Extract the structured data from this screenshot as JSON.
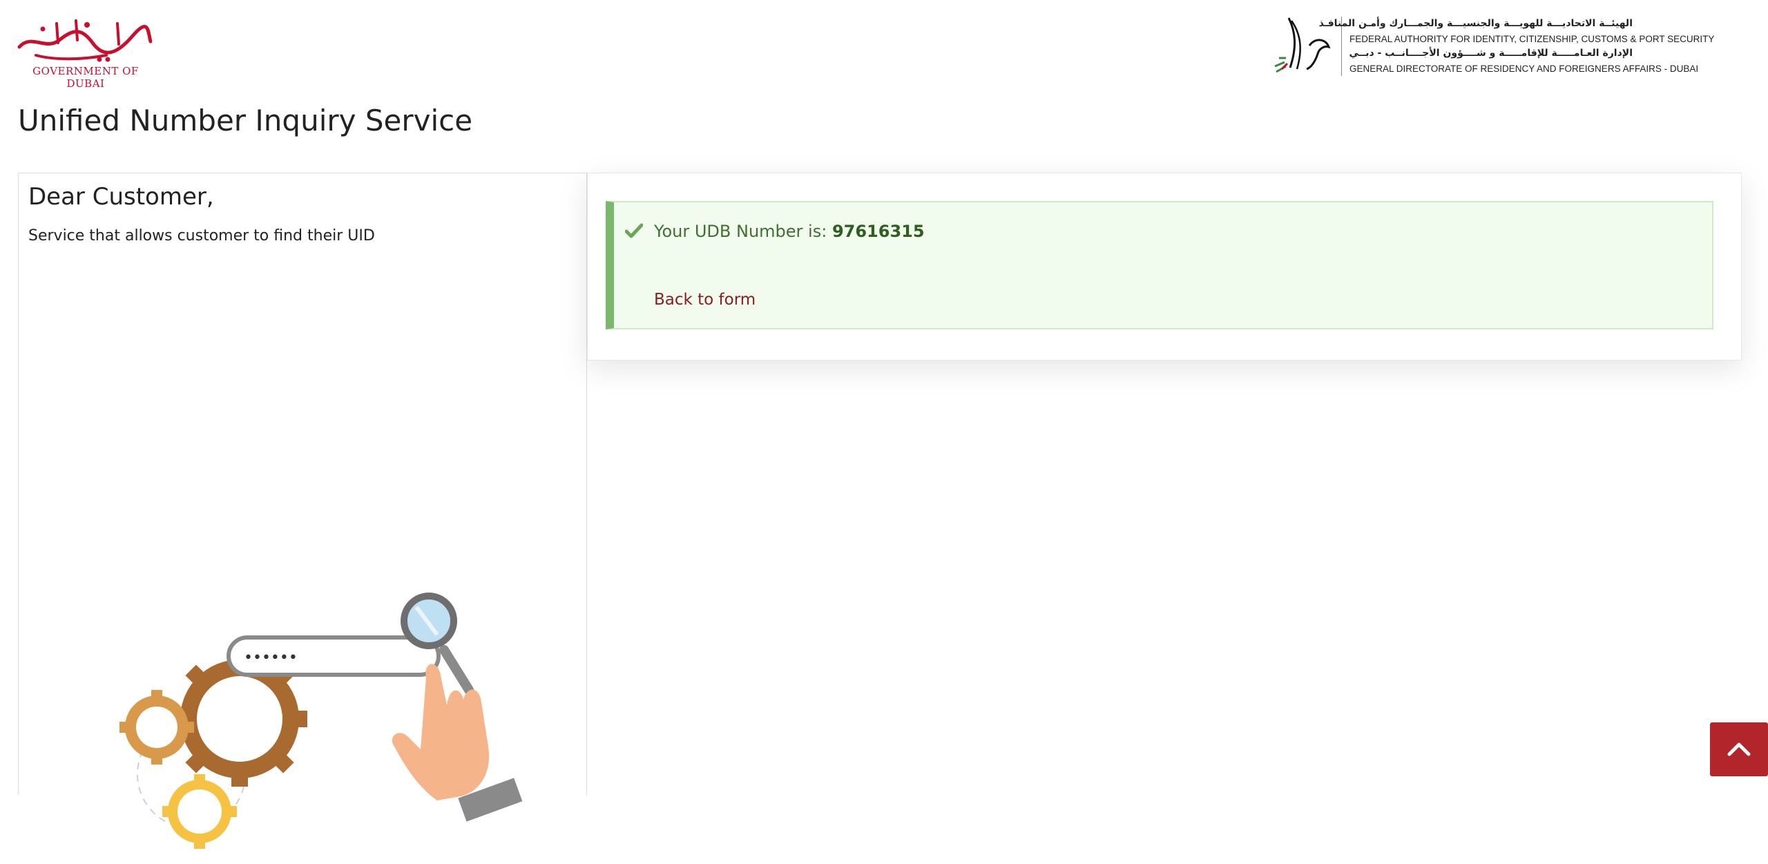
{
  "header": {
    "dubai_logo": {
      "arabic_text": "حكومة دبي",
      "caption": "GOVERNMENT OF DUBAI",
      "color": "#c8102e"
    },
    "federal_logo": {
      "line1_ar": "الهيئــة الاتحاديـــة للهويـــة والجنسيـــة والجمـــارك وأمـن المنافـذ",
      "line2_en": "FEDERAL AUTHORITY FOR IDENTITY, CITIZENSHIP, CUSTOMS & PORT SECURITY",
      "line3_ar": "الإدارة العـامـــــة للإقامـــــة و شــــؤون الأجــــانــب - دبــي",
      "line4_en": "GENERAL DIRECTORATE OF RESIDENCY AND FOREIGNERS AFFAIRS - DUBAI"
    }
  },
  "page": {
    "title": "Unified Number Inquiry Service"
  },
  "info_panel": {
    "greeting": "Dear Customer,",
    "description": "Service that allows customer to find their UID",
    "illustration_field_text": "••••••"
  },
  "result": {
    "message_prefix": "Your UDB Number is:",
    "udb_number": "97616315",
    "back_link": "Back to form",
    "accent_color": "#7ab86b",
    "background_color": "#f1fcee"
  },
  "scroll_top": {
    "icon": "chevron-up-icon",
    "color": "#b2262b"
  }
}
